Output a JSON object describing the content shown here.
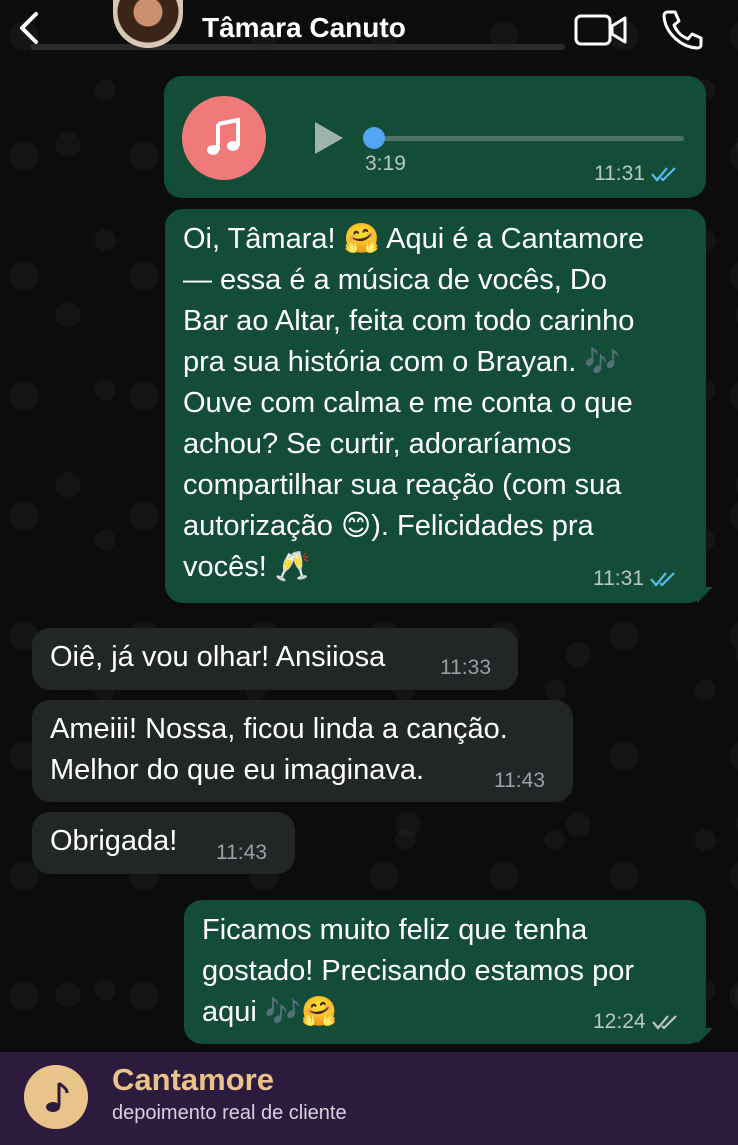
{
  "header": {
    "contact_name": "Tâmara Canuto"
  },
  "messages": [
    {
      "type": "audio",
      "direction": "out",
      "duration": "3:19",
      "time": "11:31",
      "status": "read"
    },
    {
      "type": "text",
      "direction": "out",
      "lines": [
        "Oi, Tâmara! 🤗 Aqui é a Cantamore",
        "— essa é a música de vocês, Do",
        "Bar ao Altar, feita com todo carinho",
        "pra sua história com o Brayan. 🎶",
        "Ouve com calma e me conta o que",
        "achou? Se curtir, adoraríamos",
        "compartilhar sua reação (com sua",
        "autorização 😊). Felicidades pra",
        "vocês! 🥂"
      ],
      "time": "11:31",
      "status": "read"
    },
    {
      "type": "text",
      "direction": "in",
      "lines": [
        "Oiê, já vou olhar! Ansiiosa"
      ],
      "time": "11:33"
    },
    {
      "type": "text",
      "direction": "in",
      "lines": [
        "Ameiii! Nossa, ficou linda a canção.",
        "Melhor do que eu imaginava."
      ],
      "time": "11:43"
    },
    {
      "type": "text",
      "direction": "in",
      "lines": [
        "Obrigada!"
      ],
      "time": "11:43"
    },
    {
      "type": "text",
      "direction": "out",
      "lines": [
        "Ficamos muito feliz que tenha",
        "gostado! Precisando estamos por",
        "aqui 🎶🤗"
      ],
      "time": "12:24",
      "status": "delivered"
    }
  ],
  "footer": {
    "brand_name": "Cantamore",
    "subtitle": "depoimento real de cliente"
  },
  "colors": {
    "outgoing_bubble": "#134d37",
    "incoming_bubble": "#232627",
    "read_ticks": "#53bdeb",
    "delivered_ticks": "#b7c7bf",
    "footer_bg": "#2c1b3d",
    "brand_gold": "#e8c48a"
  },
  "icons": [
    "back-arrow-icon",
    "video-call-icon",
    "phone-icon",
    "music-note-icon",
    "play-icon",
    "double-check-icon"
  ]
}
